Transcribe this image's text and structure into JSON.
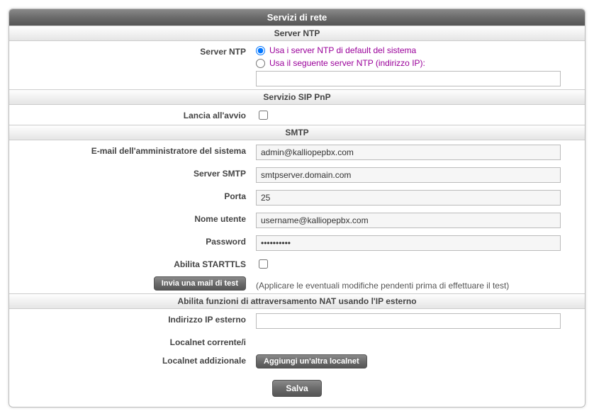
{
  "title": "Servizi di rete",
  "ntp": {
    "section_title": "Server NTP",
    "label": "Server NTP",
    "option_default": "Usa i server NTP di default del sistema",
    "option_custom": "Usa il seguente server NTP (indirizzo IP):",
    "custom_value": ""
  },
  "sip_pnp": {
    "section_title": "Servizio SIP PnP",
    "launch_label": "Lancia all'avvio"
  },
  "smtp": {
    "section_title": "SMTP",
    "admin_email_label": "E-mail dell'amministratore del sistema",
    "admin_email_value": "admin@kalliopepbx.com",
    "server_label": "Server SMTP",
    "server_value": "smtpserver.domain.com",
    "port_label": "Porta",
    "port_value": "25",
    "username_label": "Nome utente",
    "username_value": "username@kalliopepbx.com",
    "password_label": "Password",
    "password_value": "••••••••••",
    "starttls_label": "Abilita STARTTLS",
    "test_button": "Invia una mail di test",
    "test_note": "(Applicare le eventuali modifiche pendenti prima di effettuare il test)"
  },
  "nat": {
    "section_title": "Abilita funzioni di attraversamento NAT usando l'IP esterno",
    "external_ip_label": "Indirizzo IP esterno",
    "external_ip_value": "",
    "current_localnet_label": "Localnet corrente/i",
    "additional_localnet_label": "Localnet addizionale",
    "add_localnet_button": "Aggiungi un'altra localnet"
  },
  "save_button": "Salva"
}
